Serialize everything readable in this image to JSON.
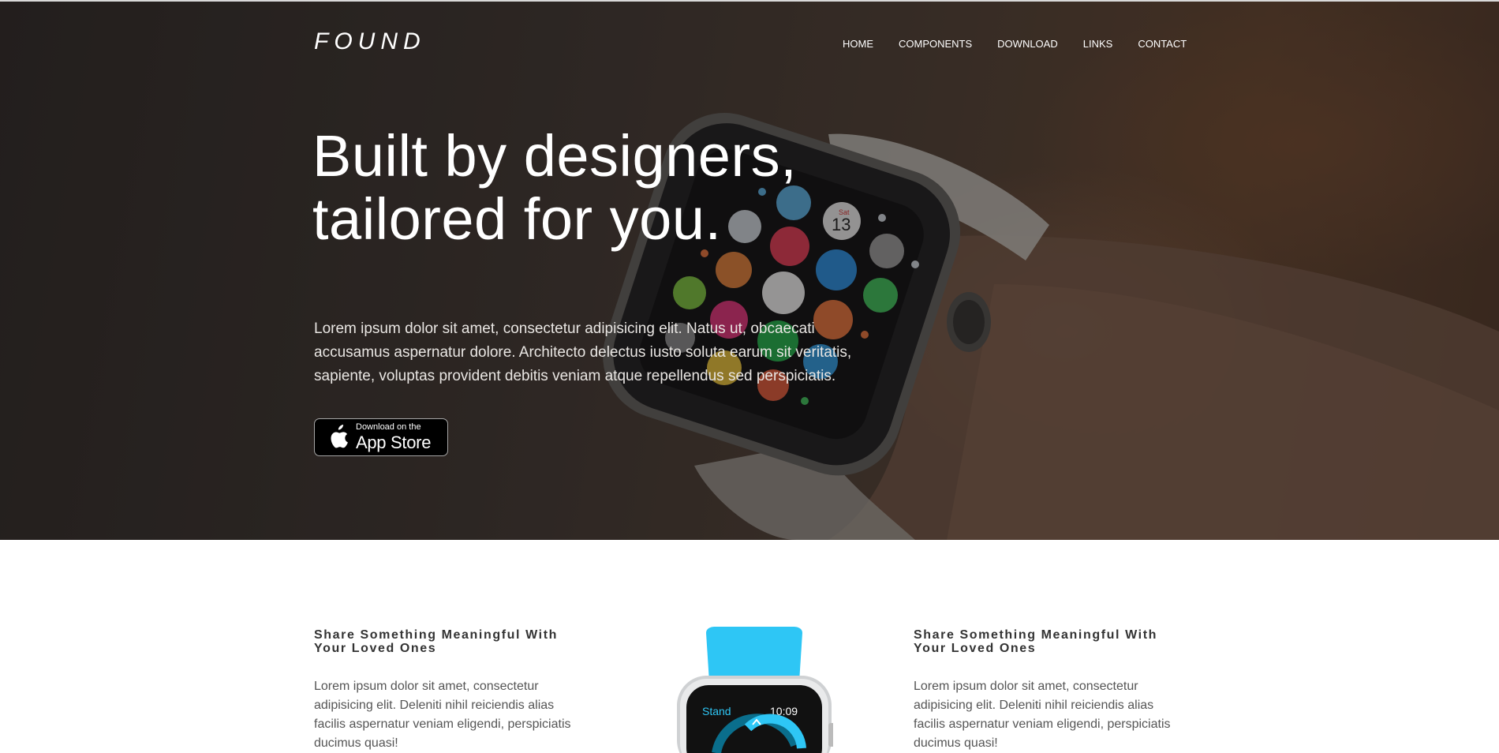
{
  "brand": {
    "logo": "FOUND"
  },
  "nav": {
    "items": [
      {
        "label": "HOME"
      },
      {
        "label": "COMPONENTS"
      },
      {
        "label": "DOWNLOAD"
      },
      {
        "label": "LINKS"
      },
      {
        "label": "CONTACT"
      }
    ]
  },
  "hero": {
    "headline_line1": "Built by designers,",
    "headline_line2": "tailored for you.",
    "lede": "Lorem ipsum dolor sit amet, consectetur adipisicing elit. Natus ut, obcaecati accusamus aspernatur dolore. Architecto delectus iusto soluta earum sit veritatis, sapiente, voluptas provident debitis veniam atque repellendus sed perspiciatis.",
    "watch_date_label": "Sat",
    "watch_date_number": "13"
  },
  "appstore_badge": {
    "small_text": "Download on the",
    "big_text": "App Store"
  },
  "features": {
    "left": {
      "title": "Share Something Meaningful With Your Loved Ones",
      "body": "Lorem ipsum dolor sit amet, consectetur adipisicing elit. Deleniti nihil reiciendis alias facilis aspernatur veniam eligendi, perspiciatis ducimus quasi!"
    },
    "right": {
      "title": "Share Something Meaningful With Your Loved Ones",
      "body": "Lorem ipsum dolor sit amet, consectetur adipisicing elit. Deleniti nihil reiciendis alias facilis aspernatur veniam eligendi, perspiciatis ducimus quasi!"
    },
    "watch_screen": {
      "label": "Stand",
      "time": "10:09"
    }
  },
  "colors": {
    "accent_cyan": "#2ec6f5",
    "hero_text": "#ffffff",
    "heading": "#333333"
  }
}
